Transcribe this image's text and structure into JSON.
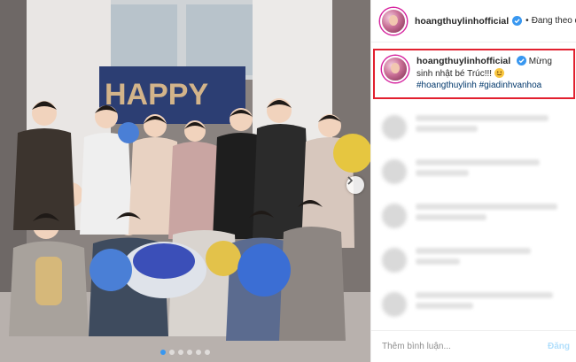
{
  "post": {
    "username": "hoangthuylinhofficial",
    "verified": true,
    "follow_separator": "•",
    "follow_state": "Đang theo dõ",
    "caption_text": "Mừng sinh nhật bé Trúc!!!",
    "caption_emoji": "smiling-face-emoji",
    "hashtags": [
      "#hoangthuylinh",
      "#giadinhvanhoa"
    ]
  },
  "comment": {
    "placeholder": "Thêm bình luận...",
    "post_label": "Đăng"
  },
  "photo": {
    "balloon_text": "HAPPY",
    "slide_count": 6,
    "active_slide": 1
  },
  "colors": {
    "highlight_border": "#e2202f",
    "verified_badge": "#3897f0",
    "hashtag": "#00376b",
    "post_button_disabled": "#b2dffc"
  },
  "icons": {
    "verified": "verified-badge-icon",
    "next": "chevron-right-icon"
  }
}
